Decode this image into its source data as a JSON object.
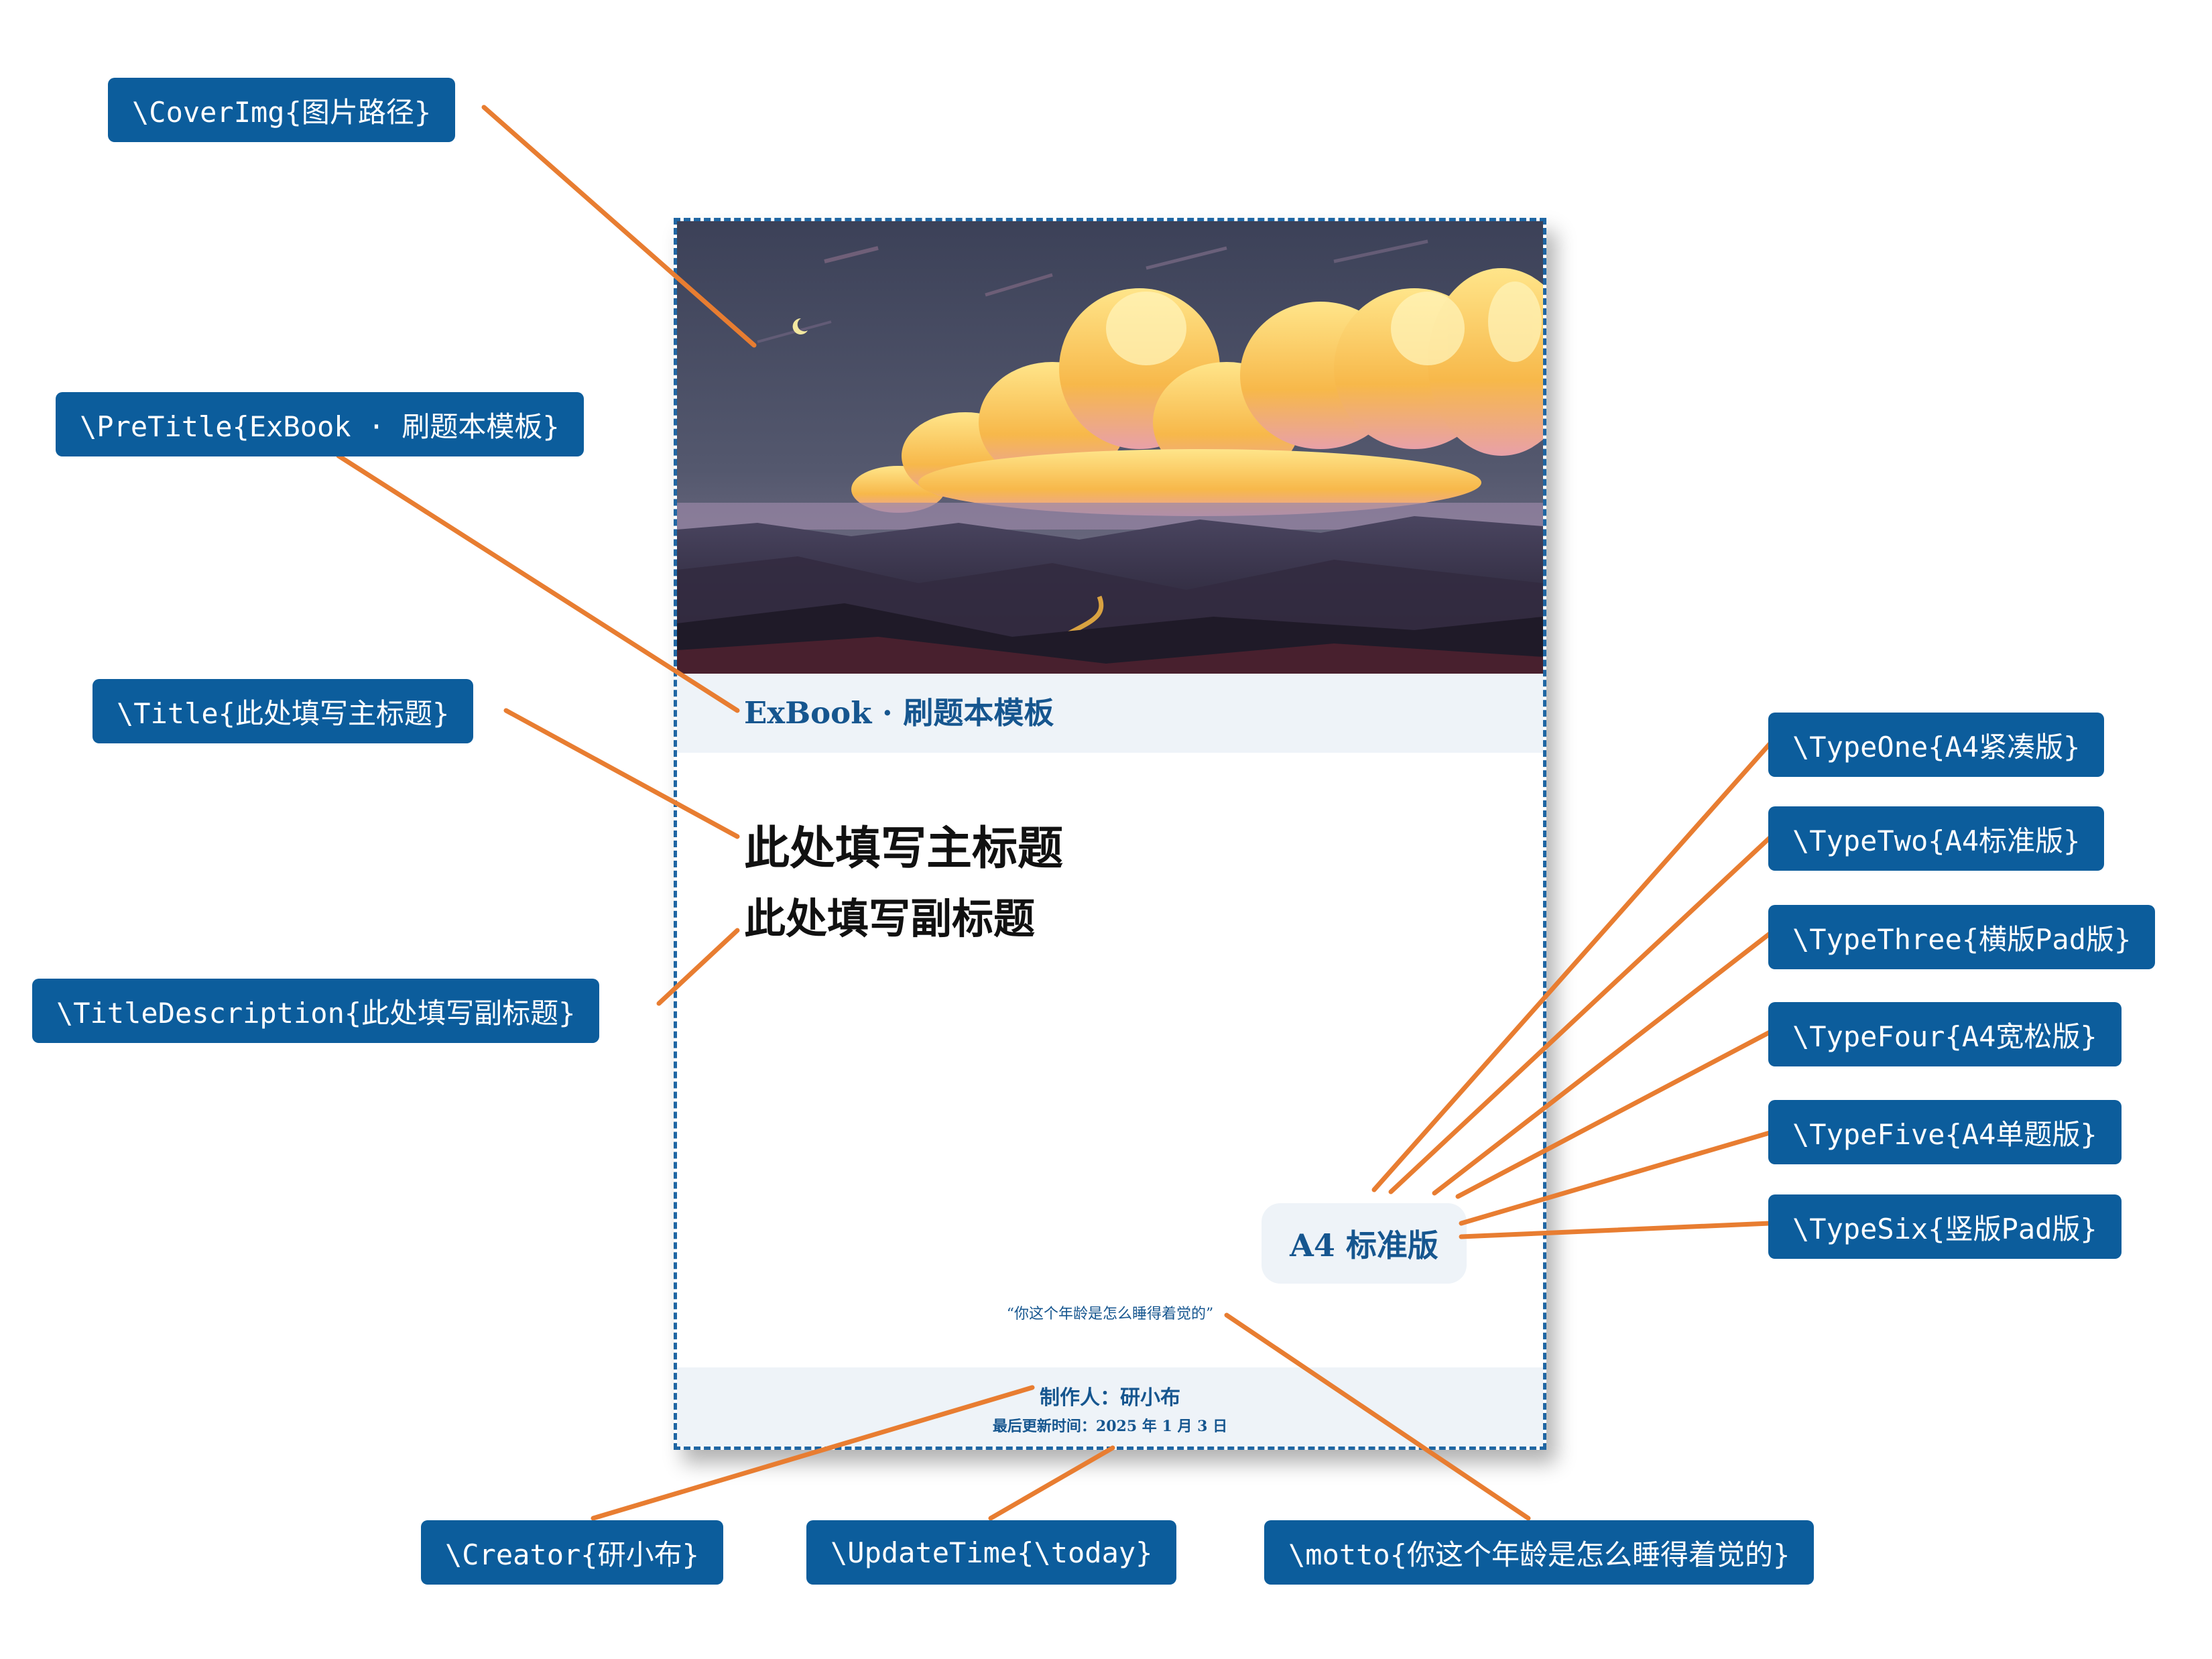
{
  "cover": {
    "pretitle": "ExBook · 刷题本模板",
    "title": "此处填写主标题",
    "subtitle": "此处填写副标题",
    "version": "A4 标准版",
    "motto": "“你这个年龄是怎么睡得着觉的”",
    "creator": "制作人：研小布",
    "update": "最后更新时间：2025 年 1 月 3 日"
  },
  "commands": {
    "cover_img": "\\CoverImg{图片路径}",
    "pre_title": "\\PreTitle{ExBook · 刷题本模板}",
    "title": "\\Title{此处填写主标题}",
    "title_description": "\\TitleDescription{此处填写副标题}",
    "type_one": "\\TypeOne{A4紧凑版}",
    "type_two": "\\TypeTwo{A4标准版}",
    "type_three": "\\TypeThree{横版Pad版}",
    "type_four": "\\TypeFour{A4宽松版}",
    "type_five": "\\TypeFive{A4单题版}",
    "type_six": "\\TypeSix{竖版Pad版}",
    "creator": "\\Creator{研小布}",
    "update_time": "\\UpdateTime{\\today}",
    "motto": "\\motto{你这个年龄是怎么睡得着觉的}"
  },
  "colors": {
    "label_background": "#0c5d9c",
    "connector": "#e87d31",
    "page_border": "#1f66a3",
    "accent_text": "#16568f",
    "band_background": "#eef3f8"
  }
}
